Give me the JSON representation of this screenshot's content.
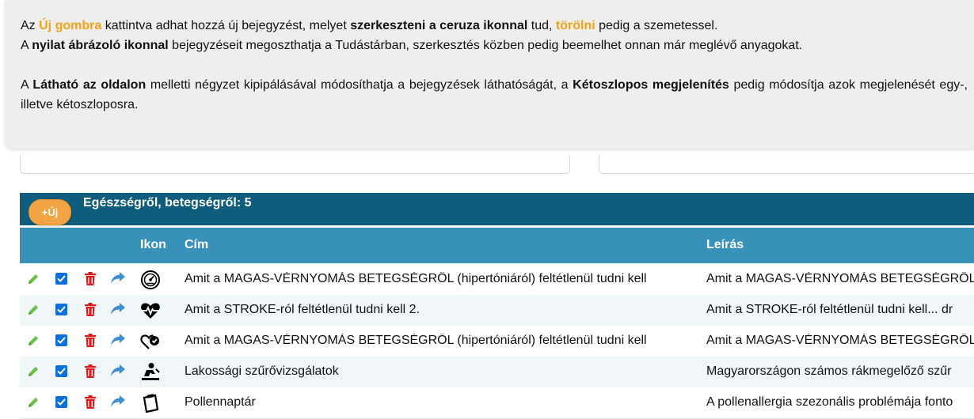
{
  "info": {
    "line1": {
      "a": "Az ",
      "b_orange": "Új gombra",
      "c": " kattintva adhat hozzá új bejegyzést, melyet ",
      "d_bold": "szerkeszteni a ceruza ikonnal",
      "e": " tud, ",
      "f_bold": "törölni",
      "g": " pedig a szemetessel."
    },
    "line2": {
      "a": "A ",
      "b_bold": "nyilat ábrázoló ikonnal",
      "c": " bejegyzéseit megoszthatja a Tudástárban, szerkesztés közben pedig beemelhet onnan már meglévő anyagokat."
    },
    "line3": {
      "a": "A ",
      "b_bold": "Látható az oldalon",
      "c": " melletti négyzet kipipálásával módosíthatja a bejegyzések láthatóságát, a ",
      "d_bold": "Kétoszlopos megjelenítés",
      "e": " pedig módosítja azok megjelenését egy-, illetve kétoszloposra."
    }
  },
  "group": {
    "new_button_label": "+Új",
    "title": "Egészségről, betegségről: 5"
  },
  "columns": {
    "icon": "Ikon",
    "title": "Cím",
    "description": "Leírás"
  },
  "rows": [
    {
      "icon": "gauge-icon",
      "title": "Amit a MAGAS-VÉRNYOMÁS BETEGSÉGRŐL (hipertóniáról) feltétlenül tudni kell",
      "description": "Amit a MAGAS-VÉRNYOMÁS BETEGSÉGRŐL",
      "checked": true
    },
    {
      "icon": "heartbeat-icon",
      "title": "Amit a STROKE-ról feltétlenül tudni kell 2.",
      "description": "Amit a STROKE-ról feltétlenül tudni kell... dr",
      "checked": true
    },
    {
      "icon": "heart-pulse-icon",
      "title": "Amit a MAGAS-VÉRNYOMÁS BETEGSÉGRŐL (hipertóniáról) feltétlenül tudni kell",
      "description": "Amit a MAGAS-VÉRNYOMÁS BETEGSÉGRŐL",
      "checked": true
    },
    {
      "icon": "person-screening-icon",
      "title": "Lakossági szűrővizsgálatok",
      "description": "Magyarországon számos rákmegelőző szűr",
      "checked": true
    },
    {
      "icon": "clipboard-icon",
      "title": "Pollennaptár",
      "description": "A pollenallergia szezonális problémája fonto",
      "checked": true
    }
  ],
  "colors": {
    "orange": "#f0a21c",
    "header_dark": "#0e5d7c",
    "header_light": "#3791b9",
    "pencil": "#6abf4b",
    "trash": "#e0191b",
    "share": "#3d8fd1",
    "checkbox": "#0d6fd8"
  }
}
